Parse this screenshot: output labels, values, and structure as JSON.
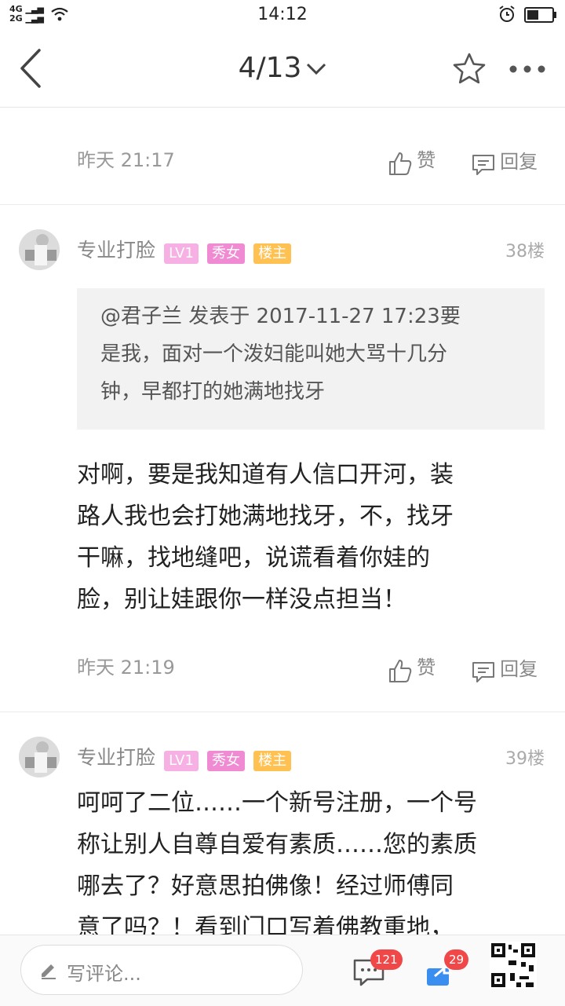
{
  "status": {
    "network": [
      "4G",
      "2G"
    ],
    "time": "14:12"
  },
  "nav": {
    "title": "4/13"
  },
  "top_meta": {
    "time": "昨天 21:17",
    "like_label": "赞",
    "reply_label": "回复"
  },
  "posts": [
    {
      "username": "专业打脸",
      "tags": [
        "LV1",
        "秀女",
        "楼主"
      ],
      "floor": "38楼",
      "quote_lines": [
        "@君子兰 发表于 2017-11-27 17:23要",
        "是我，面对一个泼妇能叫她大骂十几分",
        "钟，早都打的她满地找牙"
      ],
      "body_lines": [
        "对啊，要是我知道有人信口开河，装",
        "路人我也会打她满地找牙，不，找牙",
        "干嘛，找地缝吧，说谎看着你娃的",
        "脸，别让娃跟你一样没点担当！"
      ],
      "time": "昨天 21:19",
      "like_label": "赞",
      "reply_label": "回复"
    },
    {
      "username": "专业打脸",
      "tags": [
        "LV1",
        "秀女",
        "楼主"
      ],
      "floor": "39楼",
      "body_lines": [
        "呵呵了二位……一个新号注册，一个号",
        "称让别人自尊自爱有素质……您的素质",
        "哪去了？好意思拍佛像！经过师傅同",
        "意了吗？！看到门口写着佛教重地，"
      ]
    }
  ],
  "bottom": {
    "comment_placeholder": "写评论...",
    "comment_count": "121",
    "share_count": "29"
  },
  "colors": {
    "tag_lv": "#f6b0e4",
    "tag_girl": "#f08ad2",
    "tag_host": "#ffc152",
    "badge": "#f04848"
  }
}
